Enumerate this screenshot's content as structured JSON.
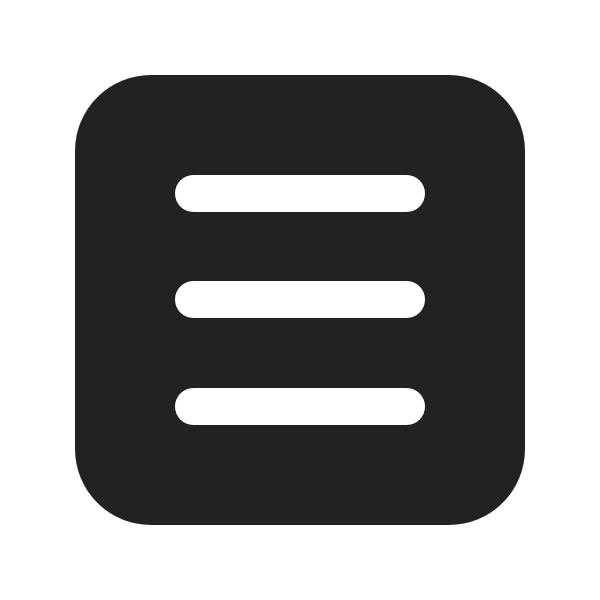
{
  "icon": {
    "name": "hamburger-menu-icon",
    "background_color": "#222222",
    "line_color": "#ffffff",
    "page_background": "#ffffff"
  }
}
